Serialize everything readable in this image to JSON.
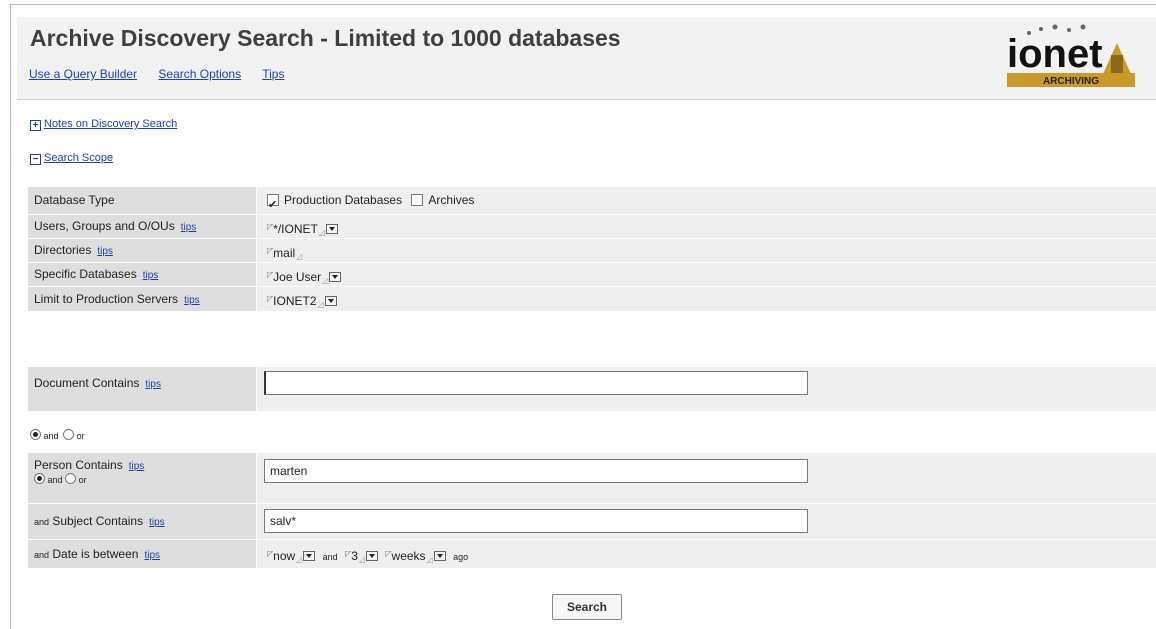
{
  "header": {
    "title": "Archive Discovery Search  - Limited to 1000 databases",
    "links": [
      "Use a Query Builder",
      "Search Options",
      "Tips"
    ],
    "logo_text": "ionet",
    "logo_subtext": "ARCHIVING"
  },
  "sections": {
    "notes": "Notes on Discovery Search",
    "scope": "Search Scope"
  },
  "tips_label": "tips",
  "scope_rows": {
    "database_type": {
      "label": "Database Type",
      "production": "Production Databases",
      "production_checked": true,
      "archives": "Archives",
      "archives_checked": false
    },
    "users": {
      "label": "Users, Groups and O/OUs",
      "value": "*/IONET"
    },
    "directories": {
      "label": "Directories",
      "value": "mail"
    },
    "specific_databases": {
      "label": "Specific Databases",
      "value": "Joe User"
    },
    "servers": {
      "label": "Limit to Production Servers",
      "value": "IONET2"
    }
  },
  "document": {
    "label": "Document Contains",
    "value": ""
  },
  "logic": {
    "and": "and",
    "or": "or"
  },
  "person": {
    "label": "Person Contains",
    "value": "marten"
  },
  "subject": {
    "prefix": "and",
    "label": "Subject Contains",
    "value": "salv*"
  },
  "date": {
    "prefix": "and",
    "label": "Date is between",
    "from": "now",
    "joiner": "and",
    "amount": "3",
    "unit": "weeks",
    "suffix": "ago"
  },
  "search_button": "Search"
}
